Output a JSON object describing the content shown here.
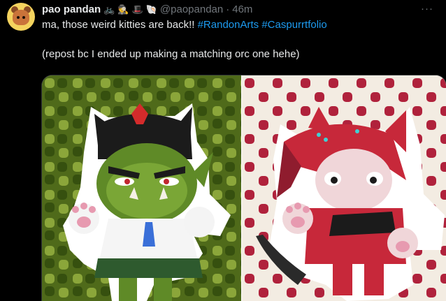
{
  "tweet": {
    "author_name": "pao pandan",
    "name_emojis": [
      "🚲",
      "🕵",
      "🎩",
      "🐚"
    ],
    "handle": "@paopandan",
    "separator": "·",
    "time": "46m",
    "more_label": "···",
    "text_main": "ma, those weird kitties are back!! ",
    "hashtags": [
      "#RandonArts",
      "#Caspurrtfolio"
    ],
    "text_note": "(repost bc I ended up making a matching orc one hehe)"
  },
  "icons": {
    "avatar": "avatar-image",
    "more": "more-options-icon"
  },
  "colors": {
    "background": "#000000",
    "text": "#e7e9ea",
    "secondary": "#71767b",
    "link": "#1d9bf0",
    "left_bg_dark": "#4f6a1a",
    "left_bg_light": "#8ba63a",
    "right_bg_red": "#b0223c",
    "right_bg_cream": "#f3ece2"
  }
}
